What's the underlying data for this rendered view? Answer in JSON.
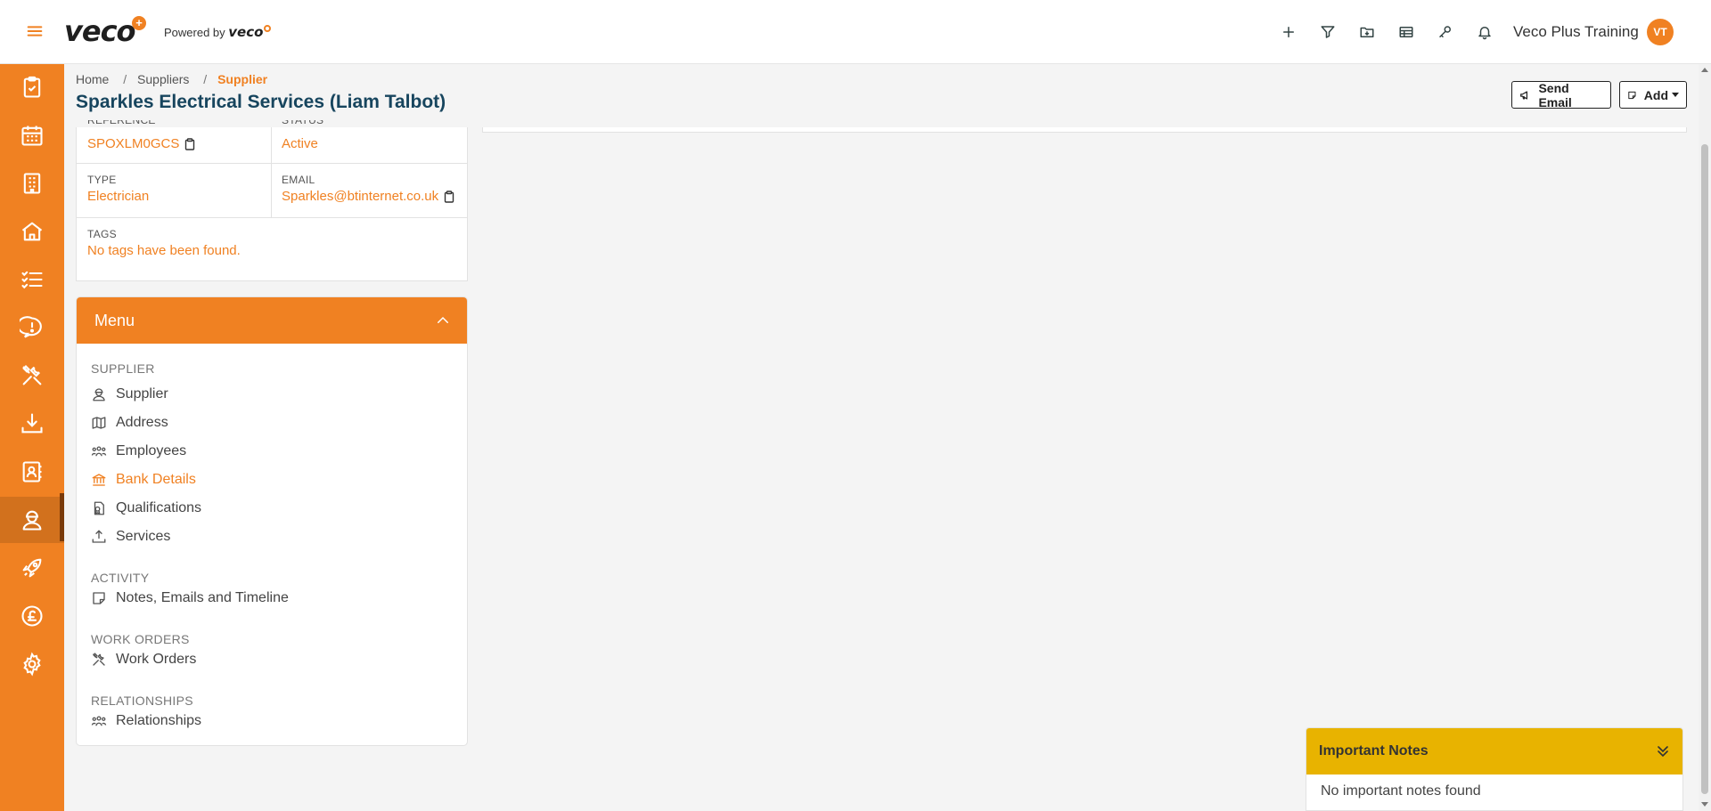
{
  "app": {
    "logo_text": "veco",
    "logo_plus": "+",
    "powered_by_label": "Powered by",
    "powered_by_logo": "veco",
    "user_name": "Veco Plus Training",
    "avatar_initials": "VT",
    "brand_color": "#f08122"
  },
  "topbar": {
    "icons": [
      "plus-icon",
      "filter-icon",
      "folder-download-icon",
      "table-icon",
      "wrench-key-icon",
      "bell-icon"
    ]
  },
  "sidebar": {
    "items": [
      {
        "icon": "clipboard-check-icon"
      },
      {
        "icon": "calendar-icon"
      },
      {
        "icon": "building-icon"
      },
      {
        "icon": "home-icon"
      },
      {
        "icon": "checklist-icon"
      },
      {
        "icon": "speech-alert-icon"
      },
      {
        "icon": "tools-icon"
      },
      {
        "icon": "download-tray-icon"
      },
      {
        "icon": "contact-book-icon"
      },
      {
        "icon": "worker-icon",
        "active": true
      },
      {
        "icon": "rocket-icon"
      },
      {
        "icon": "pound-coin-icon"
      },
      {
        "icon": "settings-gear-icon"
      }
    ]
  },
  "breadcrumb": {
    "home": "Home",
    "sep1": "/",
    "suppliers": "Suppliers",
    "sep2": "/",
    "current": "Supplier"
  },
  "page": {
    "title": "Sparkles Electrical Services (Liam Talbot)",
    "send_email_label": "Send Email",
    "add_label": "Add"
  },
  "info": {
    "reference_label": "REFERENCE",
    "reference_value": "SPOXLM0GCS",
    "status_label": "STATUS",
    "status_value": "Active",
    "type_label": "TYPE",
    "type_value": "Electrician",
    "email_label": "EMAIL",
    "email_value": "Sparkles@btinternet.co.uk",
    "tags_label": "TAGS",
    "tags_value": "No tags have been found."
  },
  "menu": {
    "title": "Menu",
    "sections": {
      "supplier": "SUPPLIER",
      "activity": "ACTIVITY",
      "work_orders": "WORK ORDERS",
      "relationships": "RELATIONSHIPS"
    },
    "items": {
      "supplier": "Supplier",
      "address": "Address",
      "employees": "Employees",
      "bank_details": "Bank Details",
      "qualifications": "Qualifications",
      "services": "Services",
      "notes": "Notes, Emails and Timeline",
      "work_orders": "Work Orders",
      "relationships": "Relationships"
    }
  },
  "important_notes": {
    "title": "Important Notes",
    "empty_text": "No important notes found",
    "color": "#e8b300"
  }
}
